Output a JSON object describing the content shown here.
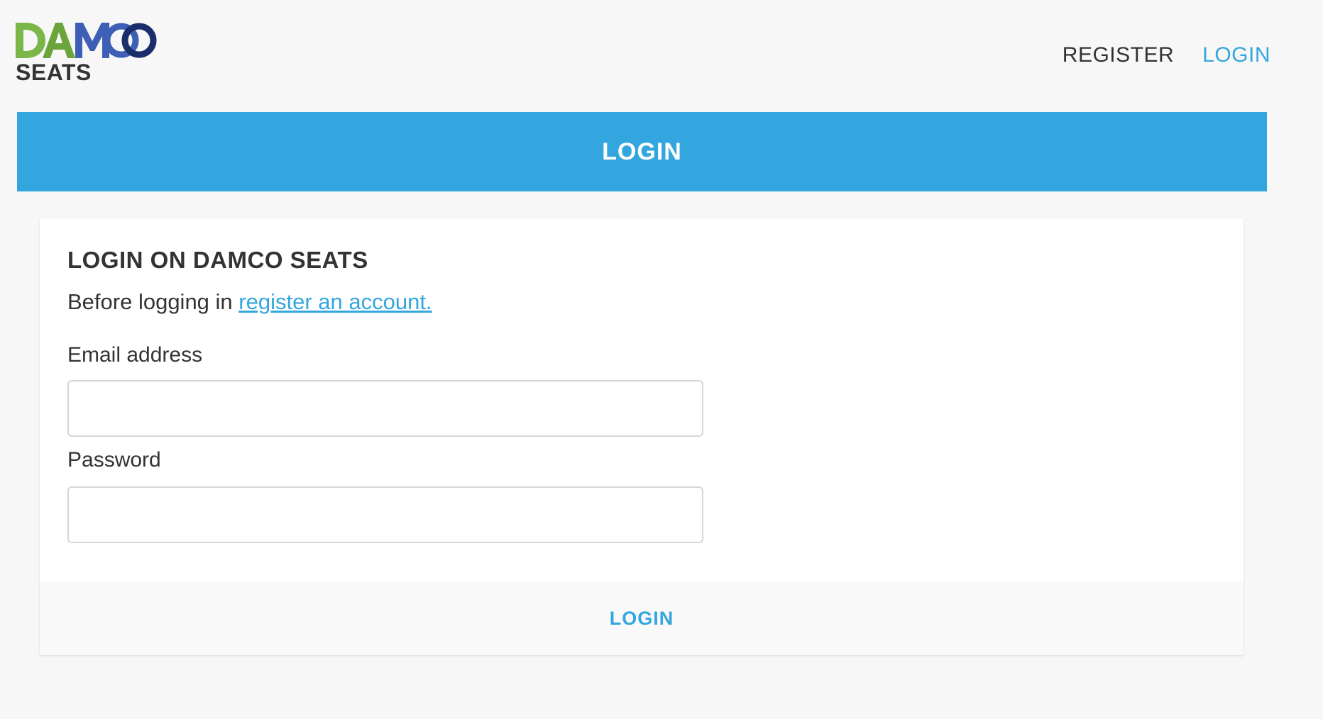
{
  "brand": {
    "logo_word": "DAMCO",
    "logo_sub": "SEATS",
    "colors": {
      "green": "#7ab648",
      "mid_blue": "#3d5fb5",
      "dark_blue": "#1b2d6b",
      "accent": "#33a6df"
    }
  },
  "top_nav": {
    "register_label": "REGISTER",
    "login_label": "LOGIN"
  },
  "banner": {
    "title": "LOGIN"
  },
  "login_form": {
    "heading": "LOGIN ON DAMCO SEATS",
    "intro_text": "Before logging in ",
    "intro_link": "register an account.",
    "email_label": "Email address",
    "email_value": "",
    "password_label": "Password",
    "password_value": "",
    "submit_label": "LOGIN"
  }
}
